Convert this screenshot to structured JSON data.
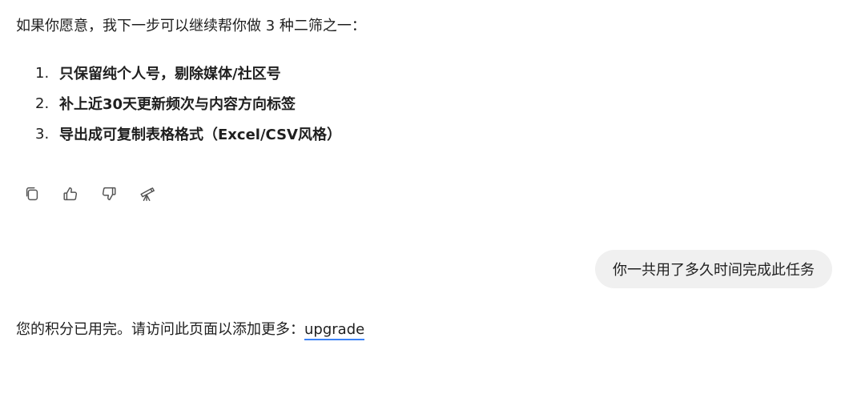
{
  "assistant_message": {
    "intro": "如果你愿意，我下一步可以继续帮你做 3 种二筛之一：",
    "options": [
      {
        "number": "1.",
        "text": "只保留纯个人号，剔除媒体/社区号"
      },
      {
        "number": "2.",
        "text": "补上近30天更新频次与内容方向标签"
      },
      {
        "number": "3.",
        "text": "导出成可复制表格格式（Excel/CSV风格）"
      }
    ]
  },
  "actions": {
    "icons": [
      "copy-icon",
      "thumbs-up-icon",
      "thumbs-down-icon",
      "telescope-icon"
    ]
  },
  "user_message": {
    "text": "你一共用了多久时间完成此任务"
  },
  "notice": {
    "text": "您的积分已用完。请访问此页面以添加更多：",
    "link_label": "upgrade",
    "link_color": "#3b82f6"
  }
}
